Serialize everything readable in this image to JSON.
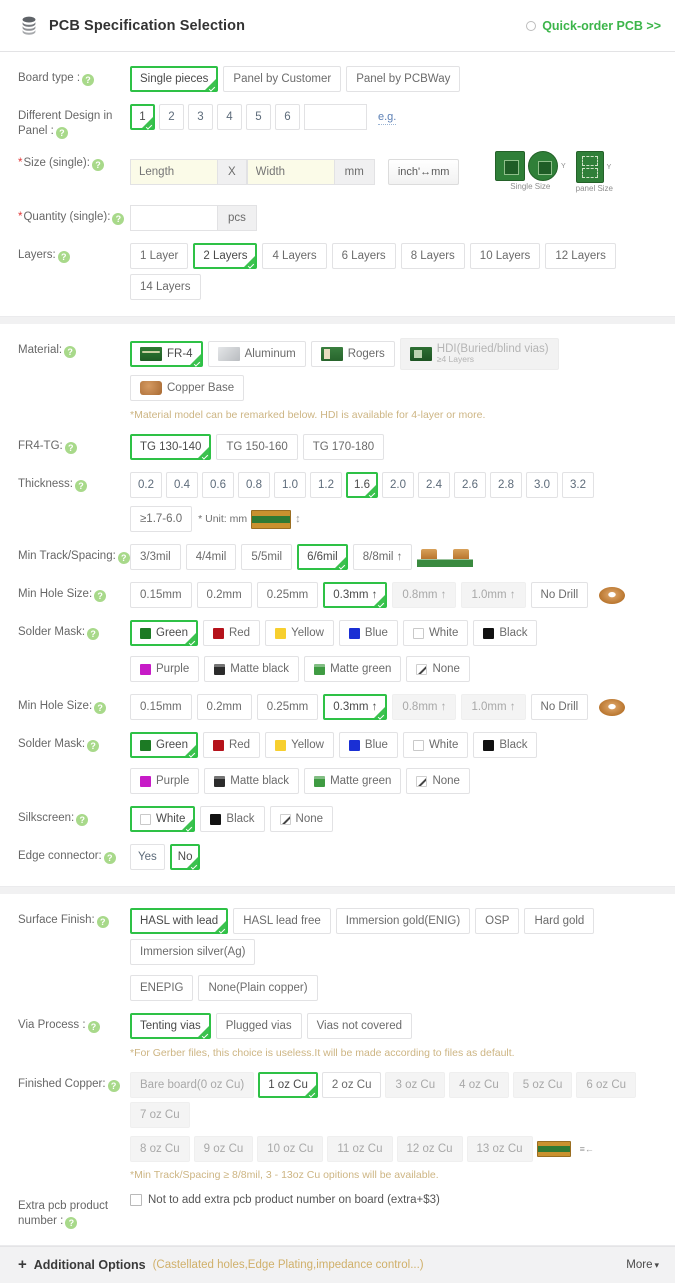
{
  "header": {
    "title": "PCB Specification Selection",
    "logo_icon": "pcb-stack-logo",
    "quick_order": "Quick-order PCB >>"
  },
  "rows": {
    "board_type": {
      "label": "Board type :",
      "options": [
        "Single pieces",
        "Panel by Customer",
        "Panel by PCBWay"
      ],
      "selected": "Single pieces"
    },
    "different_design": {
      "label": "Different Design in Panel :",
      "options": [
        "1",
        "2",
        "3",
        "4",
        "5",
        "6"
      ],
      "selected": "1",
      "custom_value": "",
      "eg_link": "e.g."
    },
    "size": {
      "label": "Size (single):",
      "required": true,
      "length_placeholder": "Length",
      "length_value": "",
      "separator": "X",
      "width_placeholder": "Width",
      "width_value": "",
      "unit": "mm",
      "convert_button": "inch'↔mm",
      "figures": [
        {
          "caption": "Single Size"
        },
        {
          "caption": "panel Size"
        }
      ]
    },
    "quantity": {
      "label": "Quantity (single):",
      "required": true,
      "value": "",
      "unit": "pcs"
    },
    "layers": {
      "label": "Layers:",
      "options": [
        "1 Layer",
        "2 Layers",
        "4 Layers",
        "6 Layers",
        "8 Layers",
        "10 Layers",
        "12 Layers",
        "14 Layers"
      ],
      "selected": "2 Layers"
    },
    "material": {
      "label": "Material:",
      "options": [
        {
          "label": "FR-4",
          "icon": "fr4-thumb",
          "state": "selected"
        },
        {
          "label": "Aluminum",
          "icon": "aluminum-thumb",
          "state": "normal"
        },
        {
          "label": "Rogers",
          "icon": "rogers-thumb",
          "state": "normal"
        },
        {
          "label": "HDI(Buried/blind vias)",
          "sublabel": "≥4 Layers",
          "icon": "hdi-thumb",
          "state": "disabled"
        },
        {
          "label": "Copper Base",
          "icon": "copper-base-thumb",
          "state": "normal"
        }
      ],
      "note": "*Material model can be remarked below. HDI is available for 4-layer or more."
    },
    "fr4_tg": {
      "label": "FR4-TG:",
      "options": [
        "TG 130-140",
        "TG 150-160",
        "TG 170-180"
      ],
      "selected": "TG 130-140"
    },
    "thickness": {
      "label": "Thickness:",
      "options": [
        "0.2",
        "0.4",
        "0.6",
        "0.8",
        "1.0",
        "1.2",
        "1.6",
        "2.0",
        "2.4",
        "2.6",
        "2.8",
        "3.0",
        "3.2"
      ],
      "selected": "1.6",
      "extra_option": "≥1.7-6.0",
      "unit_note": "* Unit: mm"
    },
    "min_track": {
      "label": "Min Track/Spacing:",
      "options": [
        "3/3mil",
        "4/4mil",
        "5/5mil",
        "6/6mil",
        "8/8mil ↑"
      ],
      "selected": "6/6mil"
    },
    "min_hole_1": {
      "label": "Min Hole Size:",
      "options": [
        {
          "label": "0.15mm",
          "state": "normal"
        },
        {
          "label": "0.2mm",
          "state": "normal"
        },
        {
          "label": "0.25mm",
          "state": "normal"
        },
        {
          "label": "0.3mm ↑",
          "state": "selected"
        },
        {
          "label": "0.8mm ↑",
          "state": "disabled"
        },
        {
          "label": "1.0mm ↑",
          "state": "disabled"
        },
        {
          "label": "No Drill",
          "state": "normal"
        }
      ]
    },
    "solder_mask_1": {
      "label": "Solder Mask:",
      "options": [
        {
          "label": "Green",
          "color": "#1c7a24",
          "state": "selected"
        },
        {
          "label": "Red",
          "color": "#b5121b",
          "state": "normal"
        },
        {
          "label": "Yellow",
          "color": "#f7cf2e",
          "state": "normal"
        },
        {
          "label": "Blue",
          "color": "#1a2fd4",
          "state": "normal"
        },
        {
          "label": "White",
          "color": "#ffffff",
          "swatch": "outline",
          "state": "normal"
        },
        {
          "label": "Black",
          "color": "#111111",
          "state": "normal"
        },
        {
          "label": "Purple",
          "color": "#c71bc7",
          "state": "normal"
        },
        {
          "label": "Matte black",
          "color": "#2b2b2b",
          "swatch": "matte",
          "state": "normal"
        },
        {
          "label": "Matte green",
          "color": "#3f9b42",
          "swatch": "matte",
          "state": "normal"
        },
        {
          "label": "None",
          "swatch": "none",
          "state": "normal"
        }
      ]
    },
    "min_hole_2": {
      "label": "Min Hole Size:",
      "options": [
        {
          "label": "0.15mm",
          "state": "normal"
        },
        {
          "label": "0.2mm",
          "state": "normal"
        },
        {
          "label": "0.25mm",
          "state": "normal"
        },
        {
          "label": "0.3mm ↑",
          "state": "selected"
        },
        {
          "label": "0.8mm ↑",
          "state": "disabled"
        },
        {
          "label": "1.0mm ↑",
          "state": "disabled"
        },
        {
          "label": "No Drill",
          "state": "normal"
        }
      ]
    },
    "solder_mask_2": {
      "label": "Solder Mask:",
      "options": [
        {
          "label": "Green",
          "color": "#1c7a24",
          "state": "selected"
        },
        {
          "label": "Red",
          "color": "#b5121b",
          "state": "normal"
        },
        {
          "label": "Yellow",
          "color": "#f7cf2e",
          "state": "normal"
        },
        {
          "label": "Blue",
          "color": "#1a2fd4",
          "state": "normal"
        },
        {
          "label": "White",
          "color": "#ffffff",
          "swatch": "outline",
          "state": "normal"
        },
        {
          "label": "Black",
          "color": "#111111",
          "state": "normal"
        },
        {
          "label": "Purple",
          "color": "#c71bc7",
          "state": "normal"
        },
        {
          "label": "Matte black",
          "color": "#2b2b2b",
          "swatch": "matte",
          "state": "normal"
        },
        {
          "label": "Matte green",
          "color": "#3f9b42",
          "swatch": "matte",
          "state": "normal"
        },
        {
          "label": "None",
          "swatch": "none",
          "state": "normal"
        }
      ]
    },
    "silkscreen": {
      "label": "Silkscreen:",
      "options": [
        {
          "label": "White",
          "color": "#ffffff",
          "swatch": "outline",
          "state": "selected"
        },
        {
          "label": "Black",
          "color": "#111111",
          "state": "normal"
        },
        {
          "label": "None",
          "swatch": "none",
          "state": "normal"
        }
      ]
    },
    "edge_connector": {
      "label": "Edge connector:",
      "options": [
        "Yes",
        "No"
      ],
      "selected": "No"
    },
    "surface_finish": {
      "label": "Surface Finish:",
      "options": [
        "HASL with lead",
        "HASL lead free",
        "Immersion gold(ENIG)",
        "OSP",
        "Hard gold",
        "Immersion silver(Ag)",
        "ENEPIG",
        "None(Plain copper)"
      ],
      "selected": "HASL with lead"
    },
    "via_process": {
      "label": "Via Process :",
      "options": [
        "Tenting vias",
        "Plugged vias",
        "Vias not covered"
      ],
      "selected": "Tenting vias",
      "note": "*For Gerber files, this choice is useless.It will be made according to files as default."
    },
    "finished_copper": {
      "label": "Finished Copper:",
      "options": [
        {
          "label": "Bare board(0 oz Cu)",
          "state": "disabled"
        },
        {
          "label": "1 oz Cu",
          "state": "selected"
        },
        {
          "label": "2 oz Cu",
          "state": "normal"
        },
        {
          "label": "3 oz Cu",
          "state": "disabled"
        },
        {
          "label": "4 oz Cu",
          "state": "disabled"
        },
        {
          "label": "5 oz Cu",
          "state": "disabled"
        },
        {
          "label": "6 oz Cu",
          "state": "disabled"
        },
        {
          "label": "7 oz Cu",
          "state": "disabled"
        },
        {
          "label": "8 oz Cu",
          "state": "disabled"
        },
        {
          "label": "9 oz Cu",
          "state": "disabled"
        },
        {
          "label": "10 oz Cu",
          "state": "disabled"
        },
        {
          "label": "11 oz Cu",
          "state": "disabled"
        },
        {
          "label": "12 oz Cu",
          "state": "disabled"
        },
        {
          "label": "13 oz Cu",
          "state": "disabled"
        }
      ],
      "note": "*Min Track/Spacing ≥ 8/8mil, 3 - 13oz Cu opitions will be available."
    },
    "extra_pcb": {
      "label": "Extra pcb product number :",
      "checkbox_label": "Not to add extra pcb product number on board (extra+$3)",
      "checked": false
    }
  },
  "footer": {
    "plus": "+",
    "title": "Additional Options",
    "subtitle": "(Castellated holes,Edge Plating,impedance control...)",
    "more": "More",
    "caret": "⌵"
  }
}
